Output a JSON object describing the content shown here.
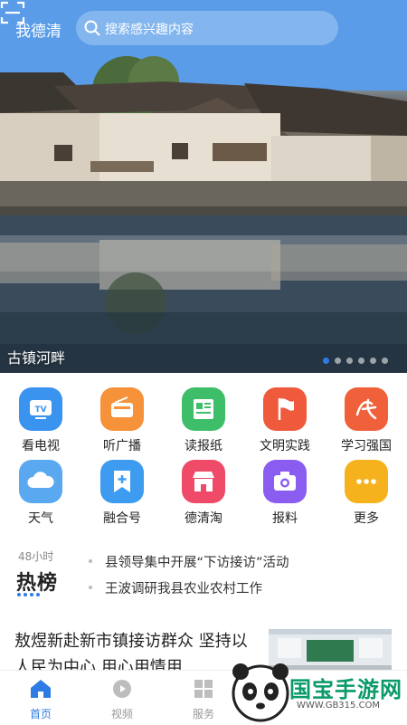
{
  "header": {
    "brand": "我德清",
    "search_placeholder": "搜索感兴趣内容",
    "scan_icon": "scan-icon"
  },
  "banner": {
    "caption": "古镇河畔",
    "slide_count": 6,
    "active_slide": 1
  },
  "quick_links": [
    {
      "label": "看电视",
      "icon": "tv-icon",
      "color": "#3b93f0"
    },
    {
      "label": "听广播",
      "icon": "radio-icon",
      "color": "#f5923a"
    },
    {
      "label": "读报纸",
      "icon": "newspaper-icon",
      "color": "#3fbe6a"
    },
    {
      "label": "文明实践",
      "icon": "flag-icon",
      "color": "#ef5a3c"
    },
    {
      "label": "学习强国",
      "icon": "study-icon",
      "color": "#f0603a"
    },
    {
      "label": "天气",
      "icon": "cloud-icon",
      "color": "#5aa8f0"
    },
    {
      "label": "融合号",
      "icon": "bookmark-plus-icon",
      "color": "#3d9cf0"
    },
    {
      "label": "德清淘",
      "icon": "shop-icon",
      "color": "#ef4a68"
    },
    {
      "label": "报料",
      "icon": "camera-icon",
      "color": "#8a5cf0"
    },
    {
      "label": "更多",
      "icon": "more-icon",
      "color": "#f5b21c"
    }
  ],
  "hot_list": {
    "label_top": "48小时",
    "title": "热榜",
    "items": [
      "县领导集中开展“下访接访”活动",
      "王波调研我县农业农村工作"
    ]
  },
  "article": {
    "title": "敖煜新赴新市镇接访群众 坚持以人民为中心 用心用情用"
  },
  "bottom_nav": [
    {
      "label": "首页",
      "icon": "home-icon",
      "active": true
    },
    {
      "label": "视频",
      "icon": "video-icon",
      "active": false
    },
    {
      "label": "服务",
      "icon": "grid-icon",
      "active": false
    }
  ],
  "watermark": {
    "text": "国宝手游网",
    "url": "WWW.GB315.COM"
  },
  "colors": {
    "accent": "#2e7ce3"
  }
}
